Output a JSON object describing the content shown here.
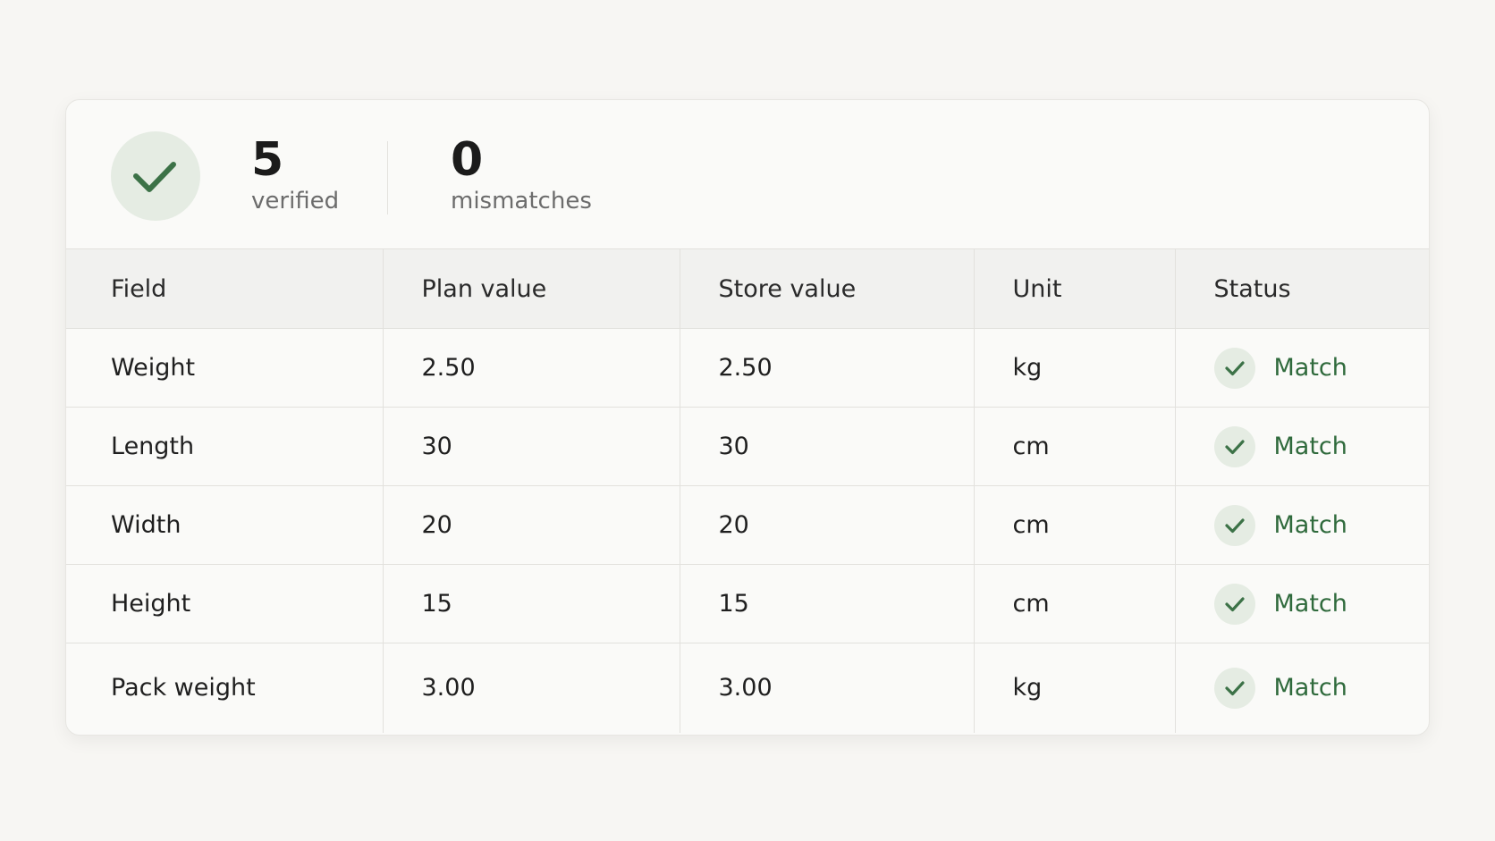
{
  "summary": {
    "verified_count": "5",
    "verified_label": "verified",
    "mismatch_count": "0",
    "mismatch_label": "mismatches"
  },
  "table": {
    "headers": [
      "Field",
      "Plan value",
      "Store value",
      "Unit",
      "Status"
    ],
    "rows": [
      {
        "field": "Weight",
        "plan": "2.50",
        "store": "2.50",
        "unit": "kg",
        "status": "Match"
      },
      {
        "field": "Length",
        "plan": "30",
        "store": "30",
        "unit": "cm",
        "status": "Match"
      },
      {
        "field": "Width",
        "plan": "20",
        "store": "20",
        "unit": "cm",
        "status": "Match"
      },
      {
        "field": "Height",
        "plan": "15",
        "store": "15",
        "unit": "cm",
        "status": "Match"
      },
      {
        "field": "Pack weight",
        "plan": "3.00",
        "store": "3.00",
        "unit": "kg",
        "status": "Match"
      }
    ]
  },
  "icons": {
    "summary": "check-icon",
    "status": "check-icon"
  },
  "colors": {
    "success": "#2f6a3c",
    "success_bg": "#e5ece3"
  }
}
